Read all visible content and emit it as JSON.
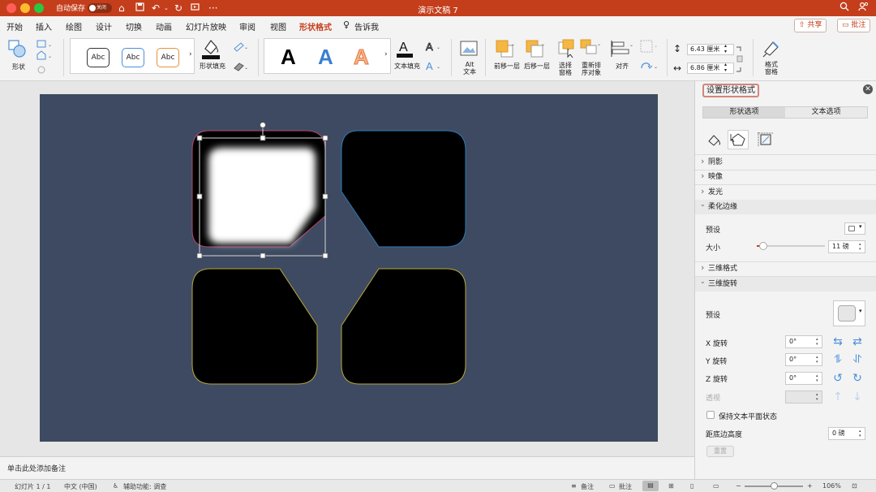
{
  "titlebar": {
    "autosave_label": "自动保存",
    "autosave_state": "关闭",
    "doc_title": "演示文稿 7",
    "more": "···"
  },
  "tabs": [
    "开始",
    "插入",
    "绘图",
    "设计",
    "切换",
    "动画",
    "幻灯片放映",
    "审阅",
    "视图",
    "形状格式",
    "告诉我"
  ],
  "active_tab": "形状格式",
  "share_label": "共享",
  "comment_label": "批注",
  "ribbon": {
    "shape_label": "形状",
    "abc": [
      "Abc",
      "Abc",
      "Abc"
    ],
    "shape_fill_label": "形状填充",
    "text_styles": [
      "A",
      "A",
      "A"
    ],
    "text_fill_label": "文本填充",
    "alt_text_label": "Alt 文本",
    "bring_forward": "前移一层",
    "send_backward": "后移一层",
    "selection_pane": "选择 窗格",
    "reorder": "重新排 序对象",
    "align": "对齐",
    "height_value": "6.43 厘米",
    "width_value": "6.86 厘米",
    "format_pane": "格式 窗格"
  },
  "notes_placeholder": "单击此处添加备注",
  "pane": {
    "title": "设置形状格式",
    "seg": [
      "形状选项",
      "文本选项"
    ],
    "sections": {
      "shadow": "阴影",
      "reflection": "映像",
      "glow": "发光",
      "soft_edges": "柔化边缘",
      "threed_format": "三维格式",
      "threed_rotation": "三维旋转"
    },
    "preset_label": "预设",
    "size_label": "大小",
    "size_value": "11 磅",
    "size_fraction": 0.1,
    "preset2_label": "预设",
    "x_rot_label": "X 旋转",
    "x_rot_value": "0°",
    "y_rot_label": "Y 旋转",
    "y_rot_value": "0°",
    "z_rot_label": "Z 旋转",
    "z_rot_value": "0°",
    "perspective_label": "透视",
    "keep_flat_label": "保持文本平面状态",
    "distance_label": "距底边高度",
    "distance_value": "0 磅",
    "reset_label": "重置"
  },
  "status": {
    "slide": "幻灯片 1 / 1",
    "language": "中文 (中国)",
    "accessibility": "辅助功能: 调查",
    "notes": "备注",
    "comments": "批注",
    "zoom": "106%"
  },
  "colors": {
    "accent": "#c43e1c",
    "slide_bg": "#3d4a61",
    "shape_fill": "#000000",
    "outline_pink": "#b8446e",
    "outline_blue": "#2f79b6",
    "outline_yellow": "#b8a73a"
  }
}
